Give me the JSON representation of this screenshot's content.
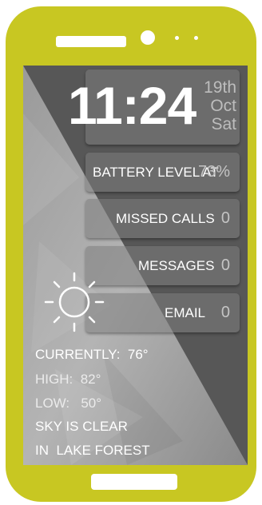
{
  "clock": {
    "time": "11:24",
    "day": "19th",
    "month": "Oct",
    "weekday": "Sat"
  },
  "tiles": [
    {
      "label": "BATTERY LEVEL AT",
      "value": "73%"
    },
    {
      "label": "MISSED CALLS",
      "value": "0"
    },
    {
      "label": "MESSAGES",
      "value": "0"
    },
    {
      "label": "EMAIL",
      "value": "0"
    }
  ],
  "weather": {
    "icon": "sun-icon",
    "currently_label": "CURRENTLY:",
    "currently_value": "76°",
    "high_label": "HIGH:",
    "high_value": "82°",
    "low_label": "LOW:",
    "low_value": "50°",
    "condition": "SKY IS CLEAR",
    "location_prefix": "IN",
    "location": "LAKE FOREST"
  },
  "colors": {
    "device_body": "#c8c722",
    "screen_bg": "#575757",
    "tile_bg": "#7d7d7d"
  }
}
